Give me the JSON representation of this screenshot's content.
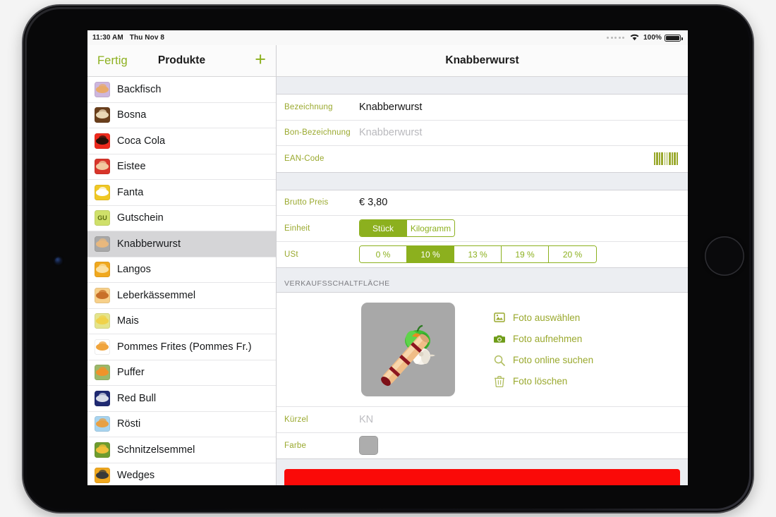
{
  "status_bar": {
    "time": "11:30 AM",
    "date": "Thu Nov 8",
    "battery_percent": "100%",
    "wifi_icon": "wifi-icon",
    "battery_icon": "battery-full-icon"
  },
  "sidebar": {
    "done_label": "Fertig",
    "title": "Produkte",
    "add_label": "+",
    "items": [
      {
        "label": "Backfisch",
        "icon": "product-icon-backfisch",
        "bg": "#cdb6dd",
        "fg": "#e8a96a"
      },
      {
        "label": "Bosna",
        "icon": "product-icon-bosna",
        "bg": "#6a3f1c",
        "fg": "#e9d7b5"
      },
      {
        "label": "Coca Cola",
        "icon": "product-icon-coca-cola",
        "bg": "#ee2a1d",
        "fg": "#2b1008"
      },
      {
        "label": "Eistee",
        "icon": "product-icon-eistee",
        "bg": "#d8352a",
        "fg": "#f2c9a0"
      },
      {
        "label": "Fanta",
        "icon": "product-icon-fanta",
        "bg": "#f0c824",
        "fg": "#ffffff"
      },
      {
        "label": "Gutschein",
        "icon": "product-icon-gutschein",
        "bg": "#cfe06a",
        "fg": "#5c6b10",
        "text": "GU"
      },
      {
        "label": "Knabberwurst",
        "icon": "product-icon-knabberwurst",
        "bg": "#a8a8a8",
        "fg": "#e8b87e",
        "selected": true
      },
      {
        "label": "Langos",
        "icon": "product-icon-langos",
        "bg": "#f0a81e",
        "fg": "#fbe0a2"
      },
      {
        "label": "Leberkässemmel",
        "icon": "product-icon-leberkaessemmel",
        "bg": "#f7d08a",
        "fg": "#c8702a"
      },
      {
        "label": "Mais",
        "icon": "product-icon-mais",
        "bg": "#e4e48c",
        "fg": "#f0d24a"
      },
      {
        "label": "Pommes Frites (Pommes Fr.)",
        "icon": "product-icon-pommes-frites",
        "bg": "#ffffff",
        "fg": "#f0a43c"
      },
      {
        "label": "Puffer",
        "icon": "product-icon-puffer",
        "bg": "#9bb86a",
        "fg": "#f0932a"
      },
      {
        "label": "Red Bull",
        "icon": "product-icon-red-bull",
        "bg": "#1f2a72",
        "fg": "#d8dce8"
      },
      {
        "label": "Rösti",
        "icon": "product-icon-roesti",
        "bg": "#a8d4ef",
        "fg": "#e8a044"
      },
      {
        "label": "Schnitzelsemmel",
        "icon": "product-icon-schnitzelsemmel",
        "bg": "#6e9c2e",
        "fg": "#f0c03a"
      },
      {
        "label": "Wedges",
        "icon": "product-icon-wedges",
        "bg": "#f0a81e",
        "fg": "#3a3a3a"
      }
    ]
  },
  "detail": {
    "title": "Knabberwurst",
    "fields": {
      "bezeichnung_label": "Bezeichnung",
      "bezeichnung_value": "Knabberwurst",
      "bon_bezeichnung_label": "Bon-Bezeichnung",
      "bon_bezeichnung_placeholder": "Knabberwurst",
      "ean_label": "EAN-Code",
      "ean_value": "",
      "ean_icon": "barcode-icon",
      "brutto_label": "Brutto Preis",
      "brutto_value": "€ 3,80",
      "einheit_label": "Einheit",
      "ust_label": "USt",
      "kuerzel_label": "Kürzel",
      "kuerzel_value": "KN",
      "farbe_label": "Farbe",
      "farbe_value": "#adadad"
    },
    "einheit_options": [
      {
        "label": "Stück",
        "selected": true
      },
      {
        "label": "Kilogramm",
        "selected": false
      }
    ],
    "ust_options": [
      {
        "label": "0 %",
        "selected": false
      },
      {
        "label": "10 %",
        "selected": true
      },
      {
        "label": "13 %",
        "selected": false
      },
      {
        "label": "19 %",
        "selected": false
      },
      {
        "label": "20 %",
        "selected": false
      }
    ],
    "photo_section_header": "VERKAUFSSCHALTFLÄCHE",
    "photo_alt": "Knabberwurst sausage with green pepper and garlic",
    "photo_actions": [
      {
        "label": "Foto auswählen",
        "icon": "photo-library-icon"
      },
      {
        "label": "Foto aufnehmen",
        "icon": "camera-icon"
      },
      {
        "label": "Foto online suchen",
        "icon": "search-icon"
      },
      {
        "label": "Foto löschen",
        "icon": "trash-icon"
      }
    ],
    "delete_button_label": ""
  },
  "colors": {
    "accent_green": "#8cb01e",
    "label_green": "#9aa92e",
    "danger_red": "#fa0a08",
    "selected_row": "#d5d5d7",
    "section_bg": "#eceef2"
  }
}
